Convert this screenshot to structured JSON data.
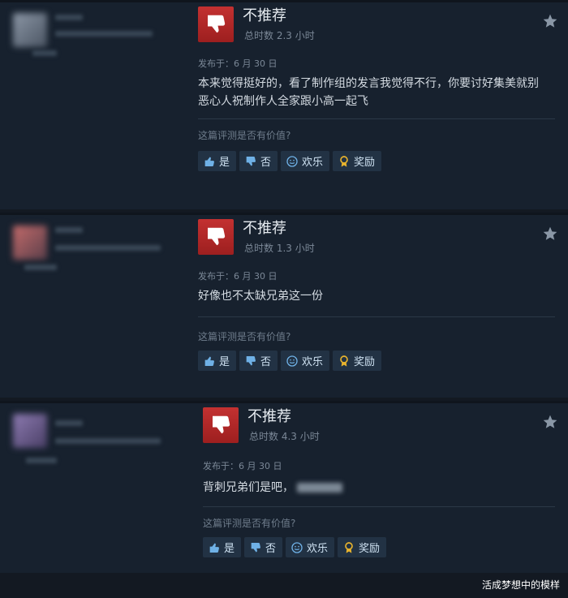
{
  "reviews": [
    {
      "verdict": "不推荐",
      "hours": "总时数 2.3 小时",
      "date": "发布于：6 月 30 日",
      "text": "本来觉得挺好的，看了制作组的发言我觉得不行，你要讨好集美就别恶心人祝制作人全家跟小高一起飞",
      "helpful_prompt": "这篇评测是否有价值?",
      "buttons": {
        "yes": "是",
        "no": "否",
        "funny": "欢乐",
        "award": "奖励"
      }
    },
    {
      "verdict": "不推荐",
      "hours": "总时数 1.3 小时",
      "date": "发布于：6 月 30 日",
      "text": "好像也不太缺兄弟这一份",
      "helpful_prompt": "这篇评测是否有价值?",
      "buttons": {
        "yes": "是",
        "no": "否",
        "funny": "欢乐",
        "award": "奖励"
      }
    },
    {
      "verdict": "不推荐",
      "hours": "总时数 4.3 小时",
      "date": "发布于：6 月 30 日",
      "text": "背刺兄弟们是吧，",
      "helpful_prompt": "这篇评测是否有价值?",
      "buttons": {
        "yes": "是",
        "no": "否",
        "funny": "欢乐",
        "award": "奖励"
      }
    }
  ],
  "icons": {
    "verdict": "thumbs-down-icon",
    "yes": "thumbs-up-icon",
    "no": "thumbs-down-icon",
    "funny": "smiley-icon",
    "award": "award-ribbon-icon",
    "corner": "star-icon"
  },
  "colors": {
    "thumb_red": "#c33131",
    "link_blue": "#6fb1e6",
    "award_gold": "#e8b32d"
  },
  "watermark": "活成梦想中的模样"
}
